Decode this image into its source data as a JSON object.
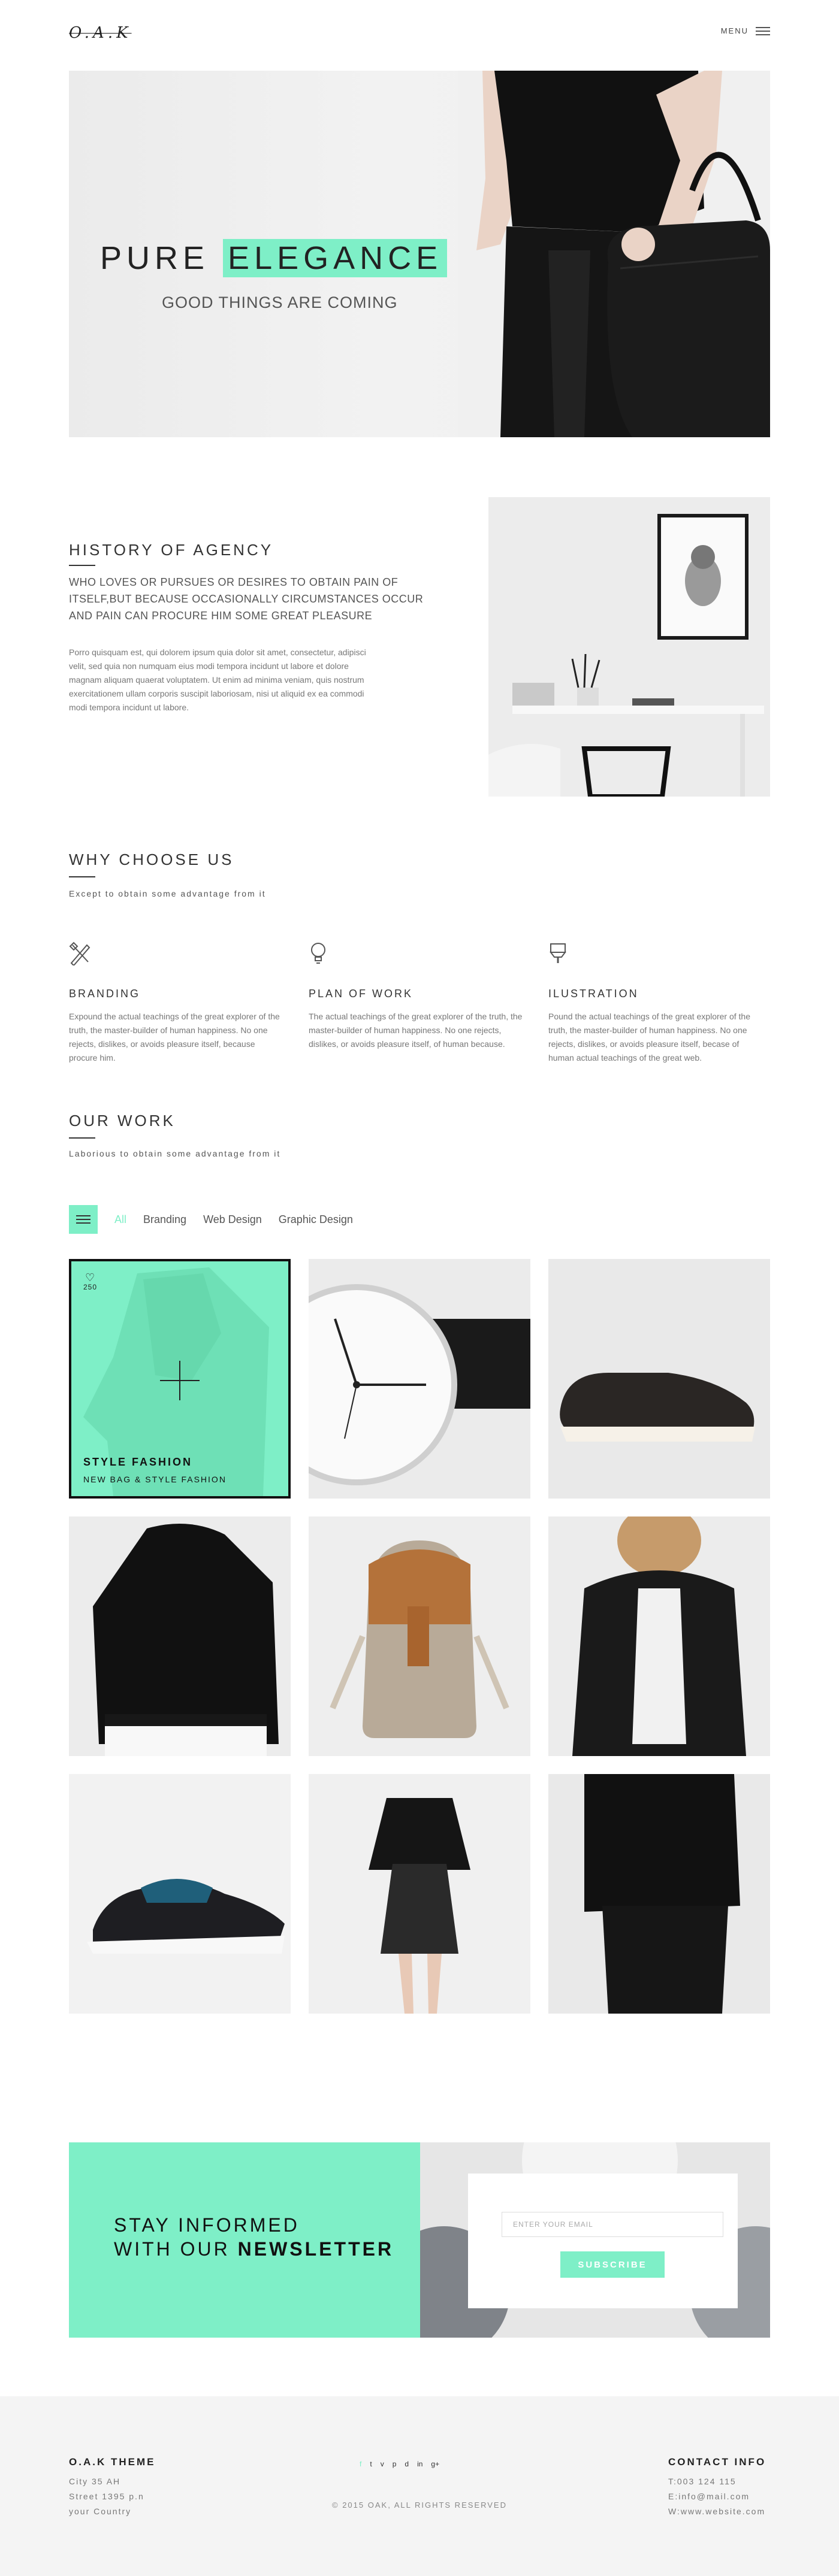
{
  "header": {
    "logo": "O.A.K",
    "menu_label": "MENU"
  },
  "hero": {
    "title_plain": "PURE ",
    "title_highlight": "ELEGANCE",
    "subtitle": "GOOD THINGS ARE COMING"
  },
  "history": {
    "title": "HISTORY OF AGENCY",
    "lead": "WHO LOVES OR PURSUES OR DESIRES TO OBTAIN PAIN OF ITSELF,BUT BECAUSE OCCASIONALLY CIRCUMSTANCES OCCUR AND PAIN CAN PROCURE HIM SOME GREAT PLEASURE",
    "body": "Porro quisquam est, qui dolorem ipsum quia dolor sit amet, consectetur, adipisci velit, sed quia non numquam eius modi tempora incidunt ut labore et dolore magnam aliquam quaerat voluptatem. Ut enim ad minima veniam, quis nostrum exercitationem ullam corporis suscipit laboriosam, nisi ut aliquid ex ea commodi modi tempora incidunt ut labore."
  },
  "why": {
    "title": "WHY CHOOSE US",
    "subtitle": "Except to obtain some advantage from it",
    "features": [
      {
        "title": "BRANDING",
        "icon": "pencil-ruler-icon",
        "text": "Expound the actual teachings of the great explorer of the truth, the master-builder of human happiness. No one rejects, dislikes, or avoids pleasure itself, because procure him."
      },
      {
        "title": "PLAN OF WORK",
        "icon": "lightbulb-icon",
        "text": "The actual teachings of the great explorer of the truth, the master-builder of human happiness. No one rejects, dislikes, or avoids pleasure itself, of human because."
      },
      {
        "title": "ILUSTRATION",
        "icon": "paint-bucket-icon",
        "text": "Pound the actual teachings of the great explorer of the truth, the master-builder of human happiness. No one rejects, dislikes, or avoids pleasure itself, becase of human actual teachings of the great  web."
      }
    ]
  },
  "work": {
    "title": "OUR WORK",
    "subtitle": "Laborious to obtain some advantage from it",
    "filters": [
      "All",
      "Branding",
      "Web Design",
      "Graphic Design"
    ],
    "featured": {
      "likes": "250",
      "title": "STYLE FASHION",
      "subtitle": "NEW BAG & STYLE FASHION"
    }
  },
  "newsletter": {
    "line1": "STAY INFORMED",
    "line2_plain": "WITH OUR ",
    "line2_bold": "NEWSLETTER",
    "placeholder": "ENTER YOUR EMAIL",
    "button": "SUBSCRIBE"
  },
  "footer": {
    "theme_title": "O.A.K THEME",
    "address": [
      "City 35 AH",
      "Street 1395 p.n",
      "your Country"
    ],
    "social": [
      "f",
      "t",
      "v",
      "p",
      "d",
      "in",
      "g+"
    ],
    "copyright": "© 2015 OAK, ALL RIGHTS RESERVED",
    "contact_title": "CONTACT INFO",
    "contact": [
      "T:003 124 115",
      "E:info@mail.com",
      "W:www.website.com"
    ]
  },
  "colors": {
    "accent": "#7eefc7"
  }
}
